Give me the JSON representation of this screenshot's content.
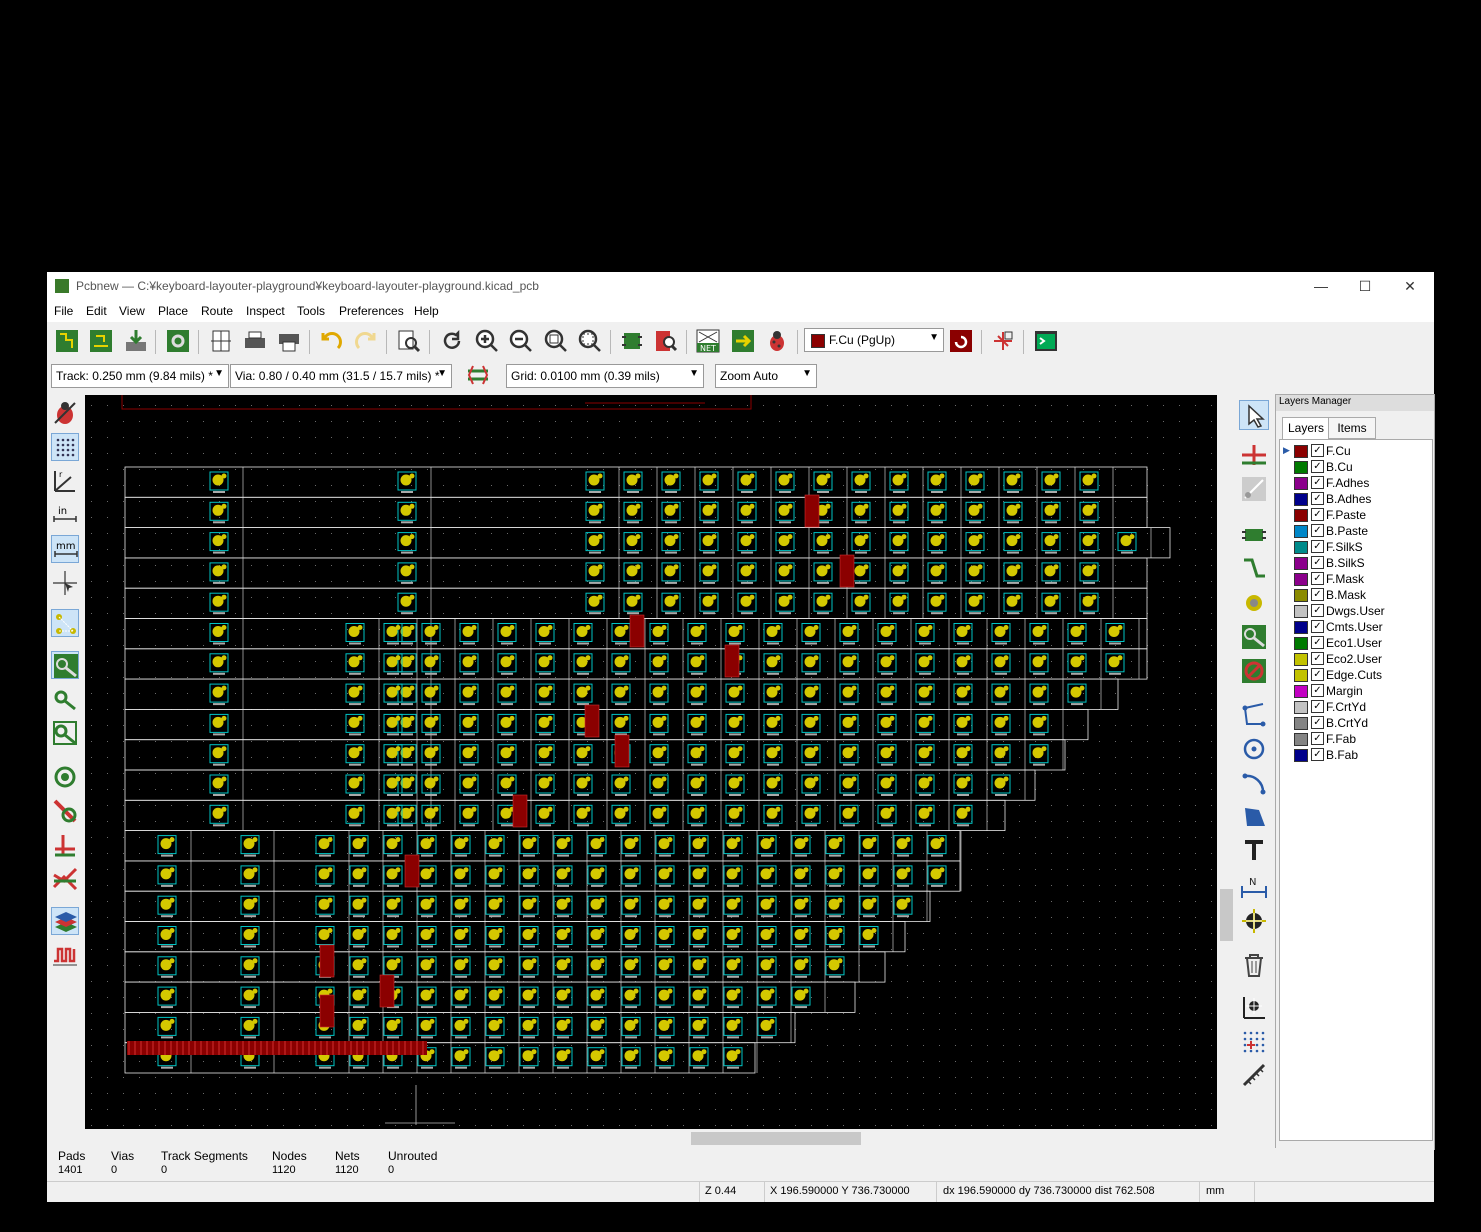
{
  "window": {
    "title": "Pcbnew — C:¥keyboard-layouter-playground¥keyboard-layouter-playground.kicad_pcb",
    "minimize": "—",
    "maximize": "☐",
    "close": "✕"
  },
  "menu": [
    "File",
    "Edit",
    "View",
    "Place",
    "Route",
    "Inspect",
    "Tools",
    "Preferences",
    "Help"
  ],
  "toolbar": {
    "layer_select": "F.Cu (PgUp)",
    "track_width": "Track: 0.250 mm (9.84 mils) *",
    "via_size": "Via: 0.80 / 0.40 mm (31.5 / 15.7 mils) *",
    "grid": "Grid: 0.0100 mm (0.39 mils)",
    "zoom": "Zoom Auto"
  },
  "layers_panel": {
    "title": "Layers Manager",
    "tabs": [
      "Layers",
      "Items"
    ],
    "active_layer": "F.Cu",
    "layers": [
      {
        "name": "F.Cu",
        "color": "#8b0000"
      },
      {
        "name": "B.Cu",
        "color": "#007a00"
      },
      {
        "name": "F.Adhes",
        "color": "#8b008b"
      },
      {
        "name": "B.Adhes",
        "color": "#00008b"
      },
      {
        "name": "F.Paste",
        "color": "#8b0000"
      },
      {
        "name": "B.Paste",
        "color": "#0087c8"
      },
      {
        "name": "F.SilkS",
        "color": "#008b8b"
      },
      {
        "name": "B.SilkS",
        "color": "#8b008b"
      },
      {
        "name": "F.Mask",
        "color": "#8b008b"
      },
      {
        "name": "B.Mask",
        "color": "#8b8b00"
      },
      {
        "name": "Dwgs.User",
        "color": "#c2c2c2"
      },
      {
        "name": "Cmts.User",
        "color": "#00008b"
      },
      {
        "name": "Eco1.User",
        "color": "#007a00"
      },
      {
        "name": "Eco2.User",
        "color": "#c2c200"
      },
      {
        "name": "Edge.Cuts",
        "color": "#c2c200"
      },
      {
        "name": "Margin",
        "color": "#c200c2"
      },
      {
        "name": "F.CrtYd",
        "color": "#c2c2c2"
      },
      {
        "name": "B.CrtYd",
        "color": "#848484"
      },
      {
        "name": "F.Fab",
        "color": "#848484"
      },
      {
        "name": "B.Fab",
        "color": "#00008b"
      }
    ]
  },
  "stats": [
    {
      "label": "Pads",
      "value": "1401"
    },
    {
      "label": "Vias",
      "value": "0"
    },
    {
      "label": "Track Segments",
      "value": "0"
    },
    {
      "label": "Nodes",
      "value": "1120"
    },
    {
      "label": "Nets",
      "value": "1120"
    },
    {
      "label": "Unrouted",
      "value": "0"
    }
  ],
  "status": {
    "zoom": "Z 0.44",
    "coords": "X 196.590000  Y 736.730000",
    "delta": "dx 196.590000  dy 736.730000  dist 762.508",
    "units": "mm"
  },
  "colors": {
    "board_bg": "#000000",
    "edge_cuts": "#e8e8e8",
    "pad": "#d4c800",
    "silk": "#00c4c4",
    "copper_front": "#8b0000"
  }
}
